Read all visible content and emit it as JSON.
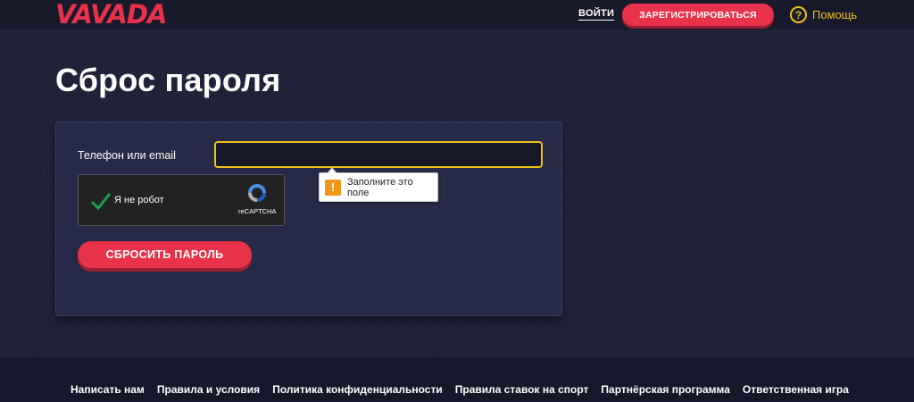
{
  "header": {
    "logo_text": "VAVADA",
    "login_label": "ВОЙТИ",
    "register_label": "ЗАРЕГИСТРИРОВАТЬСЯ",
    "help_label": "Помощь",
    "help_icon_glyph": "?"
  },
  "main": {
    "title": "Сброс пароля",
    "form": {
      "field_label": "Телефон или email",
      "field_value": "",
      "validation_message": "Заполните это поле",
      "captcha_label": "Я не робот",
      "captcha_brand": "reCAPTCHA",
      "captcha_checked": true,
      "submit_label": "СБРОСИТЬ ПАРОЛЬ"
    }
  },
  "footer": {
    "links": [
      "Написать нам",
      "Правила и условия",
      "Политика конфиденциальности",
      "Правила ставок на спорт",
      "Партнёрская программа",
      "Ответственная игра"
    ]
  },
  "colors": {
    "accent": "#e8324a",
    "help_yellow": "#f2c01c",
    "background": "#20223a",
    "warning": "#f29414"
  },
  "icons": [
    "help-icon",
    "warning-icon",
    "check-icon",
    "recaptcha-icon"
  ]
}
